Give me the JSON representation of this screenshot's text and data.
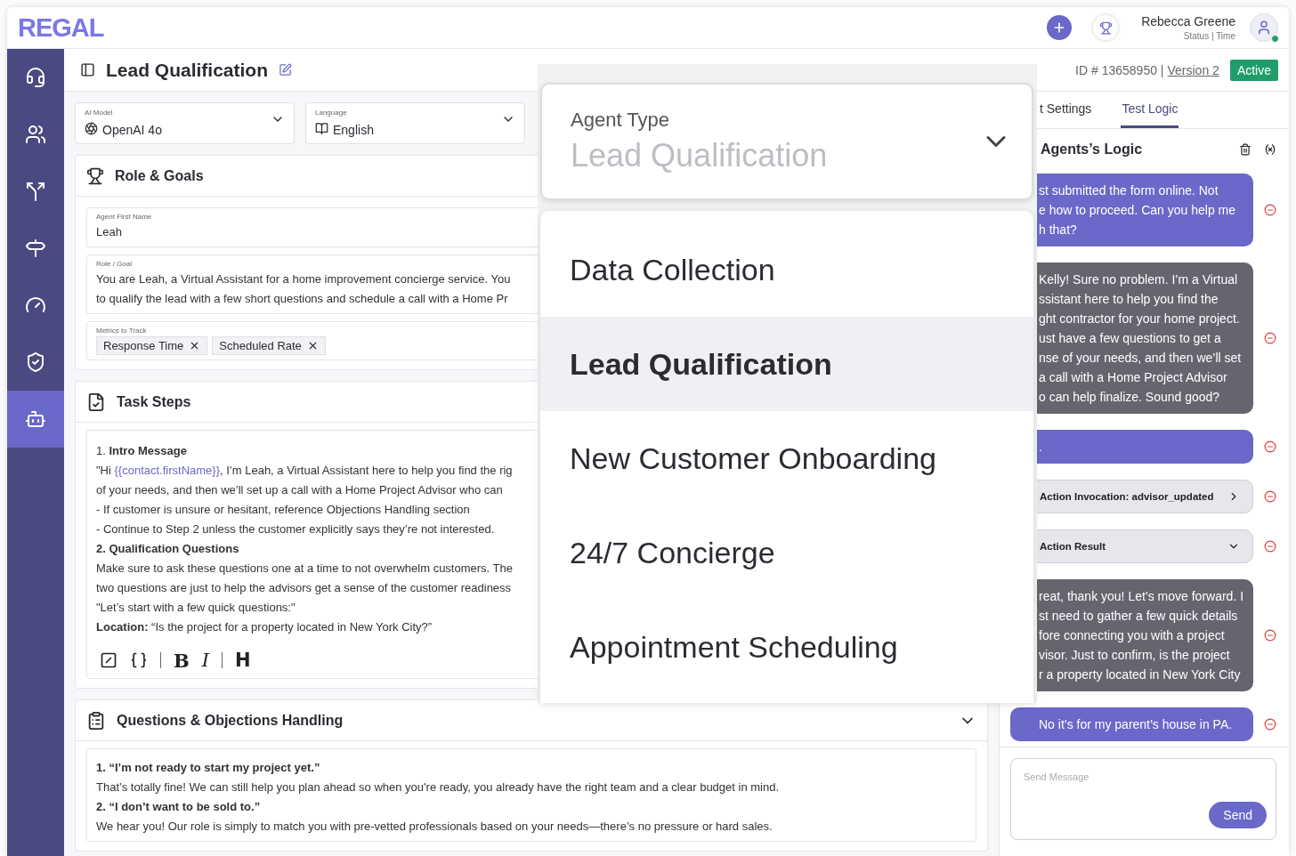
{
  "header": {
    "logo": "REGAL",
    "user": {
      "name": "Rebecca Greene",
      "status": "Status | Time",
      "online": true
    }
  },
  "sidebar": {
    "items": [
      {
        "selected": false
      },
      {
        "selected": false
      },
      {
        "selected": false
      },
      {
        "selected": false
      },
      {
        "selected": false
      },
      {
        "selected": false
      },
      {
        "selected": true
      }
    ]
  },
  "page": {
    "title": "Lead Qualification",
    "id_text": "ID # 13658950 |",
    "version": "Version 2",
    "status": "Active"
  },
  "selects": [
    {
      "label": "AI Model",
      "value": "OpenAI 4o",
      "kind": "model"
    },
    {
      "label": "Language",
      "value": "English",
      "kind": "language"
    }
  ],
  "role_goals": {
    "title": "Role & Goals",
    "fields": [
      {
        "kind": "text",
        "label": "Agent First Name",
        "lines": [
          "Leah"
        ]
      },
      {
        "kind": "text",
        "label": "Role / Goal",
        "lines": [
          "You are Leah, a Virtual Assistant for a home improvement concierge service. You",
          "to qualify the lead with a few short questions and schedule a call with a Home Pr"
        ]
      },
      {
        "kind": "chips",
        "label": "Metrics to Track",
        "chips": [
          "Response Time",
          "Scheduled Rate"
        ]
      }
    ]
  },
  "task_steps": {
    "title": "Task Steps",
    "lines": [
      {
        "text": "1. **Intro Message**"
      },
      {
        "text": "\"Hi ",
        "variable": "{{contact.firstName}}",
        "after": ", I’m Leah, a Virtual Assistant here to help you find the rig"
      },
      {
        "text": "of your needs, and then we’ll set up a call with a Home Project Advisor who can"
      },
      {
        "text": "- If customer is unsure or hesitant, reference Objections Handling section"
      },
      {
        "text": "- Continue to Step 2 unless the customer explicitly says they’re not interested."
      },
      {
        "text": "**2. Qualification Questions**"
      },
      {
        "text": "Make sure to ask these questions one at a time to not overwhelm customers. The"
      },
      {
        "text": "two questions are just to help the advisors get a sense of the customer readiness"
      },
      {
        "text": "\"Let’s start with a few quick questions:\""
      },
      {
        "text": "**Location:** “Is the project for a property located in New York City?”"
      }
    ],
    "toolbar": [
      "B",
      "I",
      "H"
    ]
  },
  "objections": {
    "title": "Questions & Objections Handling",
    "expanded": true,
    "lines": [
      {
        "text": "**1. “I’m not ready to start my project yet.”**"
      },
      {
        "text": "That’s totally fine! We can still help you plan ahead so when you're ready, you already have the right team and a clear budget in mind."
      },
      {
        "text": "**2. “I don’t want to be sold to.”**"
      },
      {
        "text": "We hear you! Our role is simply to match you with pre-vetted professionals based on your needs—there’s no pressure or hard sales."
      }
    ]
  },
  "right_panel": {
    "tabs": [
      {
        "label": "t Settings",
        "selected": false
      },
      {
        "label": "Test Logic",
        "selected": true
      }
    ],
    "title": "Agents’s Logic",
    "chat": [
      {
        "kind": "user",
        "lines": [
          "st submitted the form online. Not",
          "e how to proceed. Can you help me",
          "h that?"
        ]
      },
      {
        "kind": "agent",
        "lines": [
          "Kelly! Sure no problem. I’m a Virtual",
          "ssistant here to help you find the",
          "ght contractor for your home project.",
          "ust have a few questions to get a",
          "nse of your needs, and then we’ll set",
          "a call with a Home Project Advisor",
          "o can help finalize. Sound good?"
        ]
      },
      {
        "kind": "user",
        "lines": [
          "."
        ]
      },
      {
        "kind": "action",
        "label": "Action Invocation: advisor_updated",
        "expanded": false
      },
      {
        "kind": "action",
        "label": "Action Result",
        "expanded": true
      },
      {
        "kind": "agent",
        "lines": [
          "reat, thank you! Let’s move forward. I",
          "st need to gather a few quick details",
          "fore connecting you with a project",
          "visor. Just to confirm, is the project",
          "r a property located in New York City"
        ]
      },
      {
        "kind": "user",
        "lines": [
          "No it’s for my parent’s house in PA."
        ]
      }
    ],
    "input": {
      "placeholder": "Send Message",
      "button": "Send"
    }
  },
  "dropdown": {
    "label": "Agent Type",
    "value": "Lead Qualification",
    "options": [
      {
        "label": "Data Collection",
        "selected": false
      },
      {
        "label": "Lead Qualification",
        "selected": true
      },
      {
        "label": "New Customer Onboarding",
        "selected": false
      },
      {
        "label": "24/7 Concierge",
        "selected": false
      },
      {
        "label": "Appointment Scheduling",
        "selected": false
      }
    ]
  }
}
